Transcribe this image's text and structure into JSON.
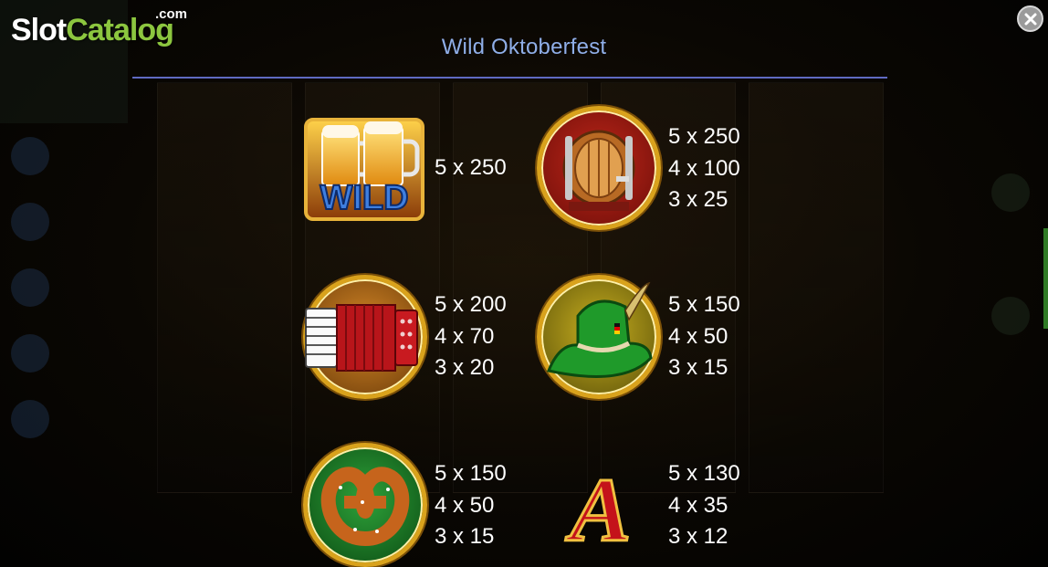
{
  "logo": {
    "slot": "Slot",
    "catalog": "Catalog",
    "com": ".com"
  },
  "paytable": {
    "title": "Wild Oktoberfest",
    "close_icon": "close-icon",
    "symbols": [
      {
        "name": "wild",
        "label": "WILD",
        "icon": "wild-beer-mugs-icon",
        "pays": [
          "5 x 250"
        ]
      },
      {
        "name": "barrel",
        "icon": "barrel-icon",
        "pays": [
          "5 x 250",
          "4 x 100",
          "3 x 25"
        ]
      },
      {
        "name": "accordion",
        "icon": "accordion-icon",
        "pays": [
          "5 x 200",
          "4 x 70",
          "3 x 20"
        ]
      },
      {
        "name": "hat",
        "icon": "hat-icon",
        "pays": [
          "5 x 150",
          "4 x 50",
          "3 x 15"
        ]
      },
      {
        "name": "pretzel",
        "icon": "pretzel-icon",
        "pays": [
          "5 x 150",
          "4 x 50",
          "3 x 15"
        ]
      },
      {
        "name": "letter-a",
        "label": "A",
        "icon": "letter-a-icon",
        "pays": [
          "5 x 130",
          "4 x 35",
          "3 x 12"
        ]
      }
    ]
  },
  "colors": {
    "title": "#8faee8",
    "divider": "#5f6ac2",
    "logo_accent": "#8cc63f",
    "gold_frame": "#d9a21c"
  }
}
